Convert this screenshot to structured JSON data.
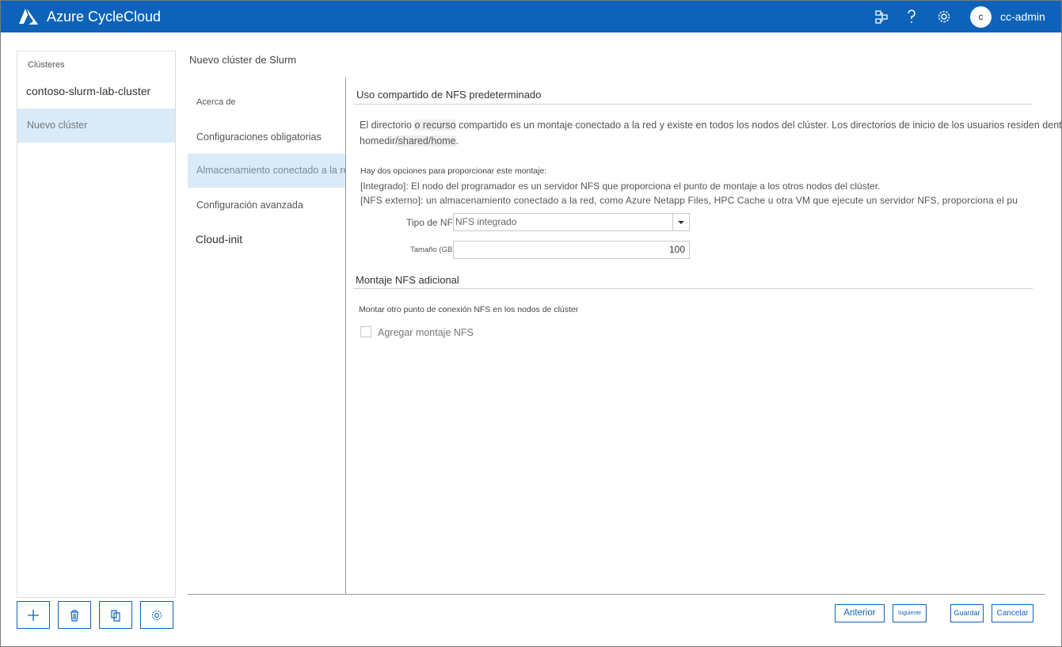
{
  "app": {
    "title": "Azure CycleCloud",
    "username": "cc-admin",
    "avatar_letter": "c",
    "accent": "#0e63b8"
  },
  "header_icons": [
    "topology-icon",
    "help-icon",
    "settings-icon"
  ],
  "sidebar": {
    "heading": "Clústeres",
    "items": [
      {
        "label": "contoso-slurm-lab-cluster"
      },
      {
        "label": "Nuevo clúster"
      }
    ],
    "buttons": [
      "add-icon",
      "delete-icon",
      "copy-icon",
      "settings-icon"
    ]
  },
  "main": {
    "title": "Nuevo clúster de Slurm",
    "steps": [
      {
        "label": "Acerca de"
      },
      {
        "label": "Configuraciones obligatorias"
      },
      {
        "label": "Almacenamiento conectado a la red"
      },
      {
        "label": "Configuración avanzada"
      },
      {
        "label": "Cloud-init"
      }
    ]
  },
  "content": {
    "section1": {
      "title": "Uso compartido de NFS predeterminado",
      "para1_a": "El directorio ",
      "para1_o": "o",
      "para1_recurso": " recurso",
      "para1_b": " compartido es un montaje conectado a la red y existe en todos los nodos del clúster. Los directorios de inicio de los usuarios residen dentro de",
      "para1_line2_a": "homedir",
      "para1_line2_hl": "/shared/home",
      "para1_line2_b": ".",
      "options_intro": "Hay dos opciones para proporcionar este montaje:",
      "option1": "[Integrado]: El nodo del programador es un servidor NFS que proporciona el punto de montaje a los otros nodos del clúster.",
      "option2": "[NFS externo]: un almacenamiento conectado a la red, como Azure Netapp Files, HPC Cache u otra VM que ejecute un servidor NFS, proporciona el pu",
      "nfs_type_label": "Tipo de NFS",
      "nfs_type_value": "NFS integrado",
      "size_label": "Tamaño (GB)",
      "size_value": "100"
    },
    "section2": {
      "title": "Montaje NFS adicional",
      "desc": "Montar otro punto de conexión NFS en los nodos de clúster",
      "checkbox_label": "Agregar montaje NFS",
      "checked": false
    }
  },
  "footer": {
    "previous": "Anterior",
    "next": "Siguiente",
    "save": "Guardar",
    "cancel": "Cancelar"
  }
}
